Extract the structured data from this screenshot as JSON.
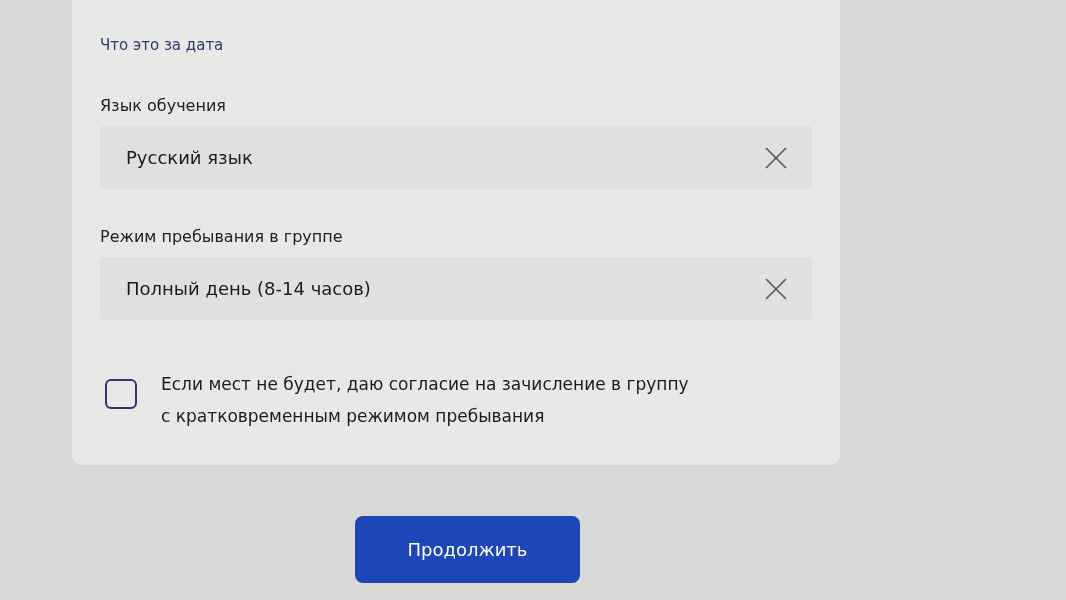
{
  "link": {
    "text": "Что это за дата"
  },
  "fields": [
    {
      "label": "Язык обучения",
      "value": "Русский язык"
    },
    {
      "label": "Режим пребывания в группе",
      "value": "Полный день (8-14 часов)"
    }
  ],
  "consent": {
    "checked": false,
    "text": "Если мест не будет, даю согласие на зачисление в группу с кратковременным режимом пребывания"
  },
  "button": {
    "label": "Продолжить"
  }
}
